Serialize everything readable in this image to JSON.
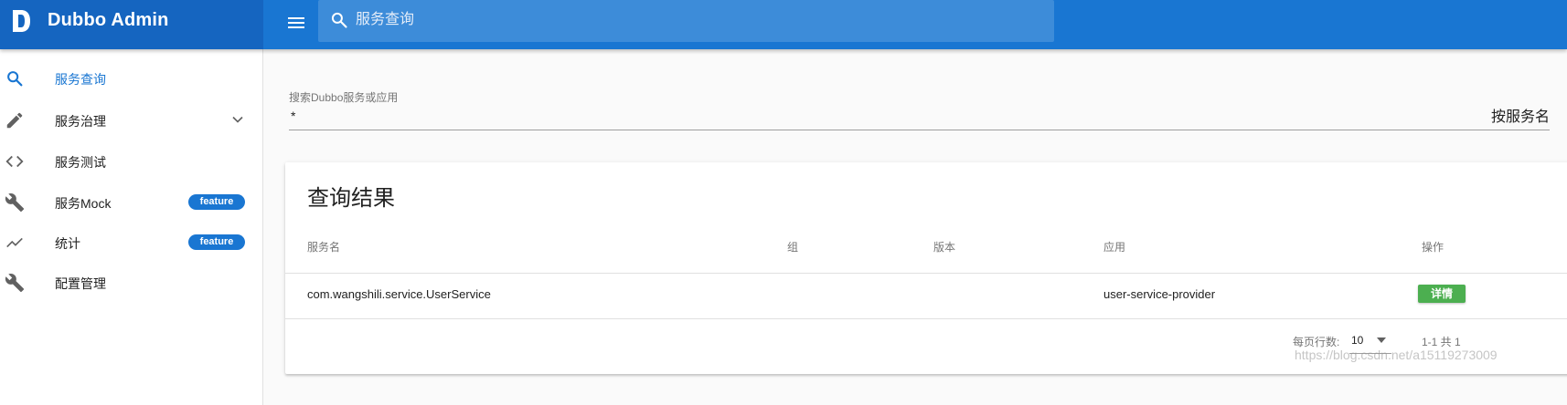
{
  "app": {
    "title": "Dubbo Admin",
    "brand_color": "#1565c0",
    "accent_color": "#1976d2"
  },
  "header": {
    "search_placeholder": "服务查询",
    "menu_icon": "menu-icon",
    "search_icon": "search-icon"
  },
  "sidebar": {
    "items": [
      {
        "label": "服务查询",
        "icon": "search-icon",
        "active": true
      },
      {
        "label": "服务治理",
        "icon": "pencil-icon",
        "expandable": true
      },
      {
        "label": "服务测试",
        "icon": "code-icon"
      },
      {
        "label": "服务Mock",
        "icon": "wrench-icon",
        "badge": "feature"
      },
      {
        "label": "统计",
        "icon": "trending-up-icon",
        "badge": "feature"
      },
      {
        "label": "配置管理",
        "icon": "wrench-icon"
      }
    ]
  },
  "filter": {
    "label": "搜索Dubbo服务或应用",
    "value": "*",
    "mode": "按服务名"
  },
  "results": {
    "title": "查询结果",
    "columns": [
      "服务名",
      "组",
      "版本",
      "应用",
      "操作"
    ],
    "rows": [
      {
        "service": "com.wangshili.service.UserService",
        "group": "",
        "version": "",
        "application": "user-service-provider",
        "action": "详情"
      }
    ],
    "footer": {
      "rows_per_page_label": "每页行数:",
      "rows_per_page": "10",
      "page_info": "1-1 共 1"
    }
  },
  "watermark": "https://blog.csdn.net/a15119273009"
}
